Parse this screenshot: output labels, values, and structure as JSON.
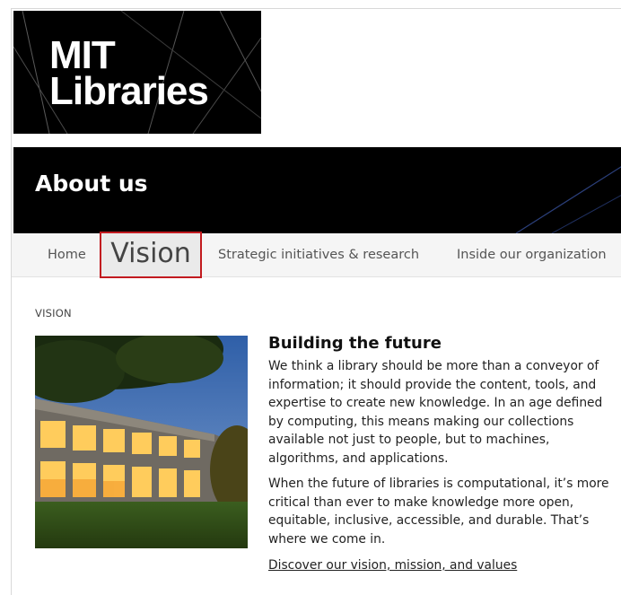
{
  "logo": {
    "line1": "MIT",
    "line2": "Libraries"
  },
  "banner": {
    "title": "About us"
  },
  "nav": {
    "home": "Home",
    "vision": "Vision",
    "strategic": "Strategic initiatives & research",
    "inside": "Inside our organization"
  },
  "breadcrumb": "VISION",
  "article": {
    "heading": "Building the future",
    "paragraph1": "We think a library should be more than a conveyor of information; it should provide the content, tools, and expertise to create new knowledge. In an age defined by computing, this means making our collections available not just to people, but to machines, algorithms, and applications.",
    "paragraph2": "When the future of libraries is computational, it’s more critical than ever to make knowledge more open, equitable, inclusive, accessible, and durable. That’s where we come in.",
    "link": "Discover our vision, mission, and values"
  },
  "colors": {
    "highlight_border": "#c21a1f",
    "banner_bg": "#000000",
    "nav_bg": "#f5f5f5"
  }
}
